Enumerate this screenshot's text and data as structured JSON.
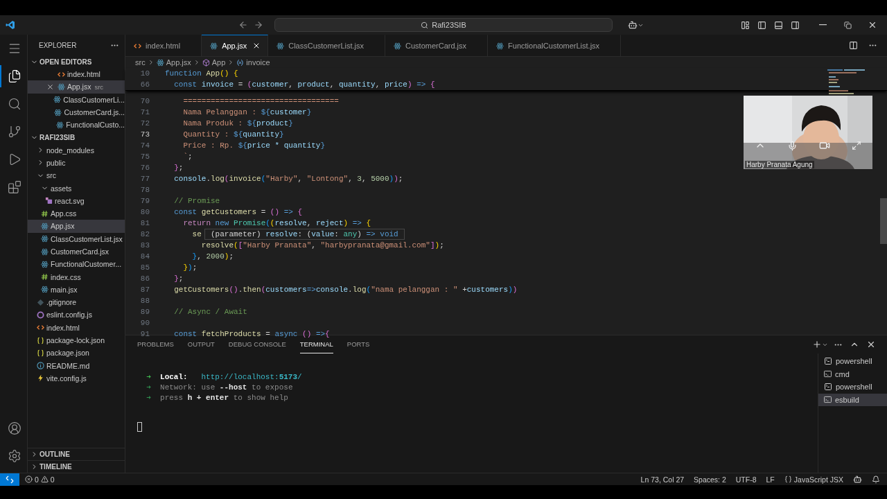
{
  "title_bar": {
    "command_center": "Rafi23SIB"
  },
  "activity_bar": {
    "items": [
      {
        "kind": "menu",
        "selected": false
      },
      {
        "kind": "explorer",
        "selected": true
      },
      {
        "kind": "search",
        "selected": false
      },
      {
        "kind": "source_control",
        "selected": false
      },
      {
        "kind": "run",
        "selected": false
      },
      {
        "kind": "extensions",
        "selected": false
      }
    ],
    "bottom_items": [
      {
        "kind": "account",
        "selected": false
      },
      {
        "kind": "settings",
        "selected": false
      }
    ]
  },
  "sidebar": {
    "title": "EXPLORER",
    "sections": [
      {
        "kind": "open_editors",
        "title": "OPEN EDITORS",
        "expanded": true,
        "items": [
          {
            "label": "index.html",
            "kind": "html",
            "selected": false
          },
          {
            "label": "App.jsx",
            "description": "src",
            "kind": "react",
            "selected": true
          },
          {
            "label": "ClassCustomerLi...",
            "kind": "react",
            "selected": false
          },
          {
            "label": "CustomerCard.js...",
            "kind": "react",
            "selected": false
          },
          {
            "label": "FunctionalCusto...",
            "kind": "react",
            "selected": false
          }
        ]
      },
      {
        "kind": "tree",
        "title": "RAFI23SIB",
        "expanded": true,
        "items": [
          {
            "label": "node_modules",
            "kind": "folder",
            "expanded": false,
            "selected": false
          },
          {
            "label": "public",
            "kind": "folder",
            "expanded": false,
            "selected": false
          },
          {
            "label": "src",
            "kind": "folder",
            "expanded": true,
            "selected": false,
            "children": [
              {
                "label": "assets",
                "kind": "folder",
                "expanded": true,
                "selected": false,
                "children": [
                  {
                    "label": "react.svg",
                    "kind": "svg",
                    "selected": false
                  }
                ]
              },
              {
                "label": "App.css",
                "kind": "css",
                "selected": false
              },
              {
                "label": "App.jsx",
                "kind": "react",
                "selected": true
              },
              {
                "label": "ClassCustomerList.jsx",
                "kind": "react",
                "selected": false
              },
              {
                "label": "CustomerCard.jsx",
                "kind": "react",
                "selected": false
              },
              {
                "label": "FunctionalCustomer...",
                "kind": "react",
                "selected": false
              },
              {
                "label": "index.css",
                "kind": "css",
                "selected": false
              },
              {
                "label": "main.jsx",
                "kind": "react",
                "selected": false
              }
            ]
          },
          {
            "label": ".gitignore",
            "kind": "git",
            "selected": false
          },
          {
            "label": "eslint.config.js",
            "kind": "eslint",
            "selected": false
          },
          {
            "label": "index.html",
            "kind": "html",
            "selected": false
          },
          {
            "label": "package-lock.json",
            "kind": "json",
            "selected": false
          },
          {
            "label": "package.json",
            "kind": "json",
            "selected": false
          },
          {
            "label": "README.md",
            "kind": "info",
            "selected": false
          },
          {
            "label": "vite.config.js",
            "kind": "vite",
            "selected": false
          }
        ]
      },
      {
        "kind": "collapsed",
        "title": "OUTLINE",
        "expanded": false
      },
      {
        "kind": "collapsed",
        "title": "TIMELINE",
        "expanded": false
      }
    ]
  },
  "tabs": [
    {
      "label": "index.html",
      "kind": "html",
      "selected": false
    },
    {
      "label": "App.jsx",
      "kind": "react",
      "selected": true
    },
    {
      "label": "ClassCustomerList.jsx",
      "kind": "react",
      "selected": false
    },
    {
      "label": "CustomerCard.jsx",
      "kind": "react",
      "selected": false
    },
    {
      "label": "FunctionalCustomerList.jsx",
      "kind": "react",
      "selected": false
    }
  ],
  "breadcrumb": [
    {
      "label": "src",
      "kind": "folder"
    },
    {
      "label": "App.jsx",
      "kind": "react"
    },
    {
      "label": "App",
      "kind": "component"
    },
    {
      "label": "invoice",
      "kind": "variable"
    }
  ],
  "editor": {
    "sticky_lines": [
      {
        "number": "10",
        "current": false,
        "tokens": [
          {
            "text": "function ",
            "kind": "kw"
          },
          {
            "text": "App",
            "kind": "fn"
          },
          {
            "text": "() {",
            "kind": "b1"
          }
        ]
      },
      {
        "number": "66",
        "current": false,
        "tokens": [
          {
            "text": "  const ",
            "kind": "kw"
          },
          {
            "text": "invoice",
            "kind": "var"
          },
          {
            "text": " = ",
            "kind": "op"
          },
          {
            "text": "(",
            "kind": "b2"
          },
          {
            "text": "customer",
            "kind": "var"
          },
          {
            "text": ", ",
            "kind": "op"
          },
          {
            "text": "product",
            "kind": "var"
          },
          {
            "text": ", ",
            "kind": "op"
          },
          {
            "text": "quantity",
            "kind": "var"
          },
          {
            "text": ", ",
            "kind": "op"
          },
          {
            "text": "price",
            "kind": "var"
          },
          {
            "text": ")",
            "kind": "b2"
          },
          {
            "text": " => ",
            "kind": "kw"
          },
          {
            "text": "{",
            "kind": "b2"
          }
        ]
      }
    ],
    "lines": [
      {
        "number": "70",
        "current": false,
        "tokens": [
          {
            "text": "    ==================================",
            "kind": "str"
          }
        ]
      },
      {
        "number": "71",
        "current": false,
        "tokens": [
          {
            "text": "    Nama Pelanggan : ",
            "kind": "str"
          },
          {
            "text": "${",
            "kind": "kw"
          },
          {
            "text": "customer",
            "kind": "var"
          },
          {
            "text": "}",
            "kind": "kw"
          }
        ]
      },
      {
        "number": "72",
        "current": false,
        "tokens": [
          {
            "text": "    Nama Produk : ",
            "kind": "str"
          },
          {
            "text": "${",
            "kind": "kw"
          },
          {
            "text": "product",
            "kind": "var"
          },
          {
            "text": "}",
            "kind": "kw"
          }
        ]
      },
      {
        "number": "73",
        "current": true,
        "tokens": [
          {
            "text": "    Quantity : ",
            "kind": "str"
          },
          {
            "text": "${",
            "kind": "kw"
          },
          {
            "text": "quantity",
            "kind": "var"
          },
          {
            "text": "}",
            "kind": "kw"
          }
        ]
      },
      {
        "number": "74",
        "current": false,
        "tokens": [
          {
            "text": "    Price : Rp. ",
            "kind": "str"
          },
          {
            "text": "${",
            "kind": "kw"
          },
          {
            "text": "price * quantity",
            "kind": "var"
          },
          {
            "text": "}",
            "kind": "kw"
          }
        ]
      },
      {
        "number": "75",
        "current": false,
        "tokens": [
          {
            "text": "    `",
            "kind": "str"
          },
          {
            "text": ";",
            "kind": "op"
          }
        ]
      },
      {
        "number": "76",
        "current": false,
        "tokens": [
          {
            "text": "  }",
            "kind": "b2"
          },
          {
            "text": ";",
            "kind": "op"
          }
        ]
      },
      {
        "number": "77",
        "current": false,
        "tokens": [
          {
            "text": "  console",
            "kind": "var"
          },
          {
            "text": ".",
            "kind": "op"
          },
          {
            "text": "log",
            "kind": "fn"
          },
          {
            "text": "(",
            "kind": "b2"
          },
          {
            "text": "invoice",
            "kind": "fn"
          },
          {
            "text": "(",
            "kind": "b3"
          },
          {
            "text": "\"Harby\"",
            "kind": "str"
          },
          {
            "text": ", ",
            "kind": "op"
          },
          {
            "text": "\"Lontong\"",
            "kind": "str"
          },
          {
            "text": ", ",
            "kind": "op"
          },
          {
            "text": "3",
            "kind": "num"
          },
          {
            "text": ", ",
            "kind": "op"
          },
          {
            "text": "5000",
            "kind": "num"
          },
          {
            "text": ")",
            "kind": "b3"
          },
          {
            "text": ")",
            "kind": "b2"
          },
          {
            "text": ";",
            "kind": "op"
          }
        ]
      },
      {
        "number": "78",
        "current": false
      },
      {
        "number": "79",
        "current": false,
        "tokens": [
          {
            "text": "  // Promise",
            "kind": "cmt"
          }
        ]
      },
      {
        "number": "80",
        "current": false,
        "tokens": [
          {
            "text": "  const ",
            "kind": "kw"
          },
          {
            "text": "getCustomers",
            "kind": "fn"
          },
          {
            "text": " = ",
            "kind": "op"
          },
          {
            "text": "()",
            "kind": "b2"
          },
          {
            "text": " => ",
            "kind": "kw"
          },
          {
            "text": "{",
            "kind": "b2"
          }
        ]
      },
      {
        "number": "81",
        "current": false,
        "tokens": [
          {
            "text": "    return",
            "kind": "ctl"
          },
          {
            "text": " new ",
            "kind": "kw"
          },
          {
            "text": "Promise",
            "kind": "type"
          },
          {
            "text": "(",
            "kind": "b3"
          },
          {
            "text": "(",
            "kind": "b1"
          },
          {
            "text": "resolve",
            "kind": "var"
          },
          {
            "text": ", ",
            "kind": "op"
          },
          {
            "text": "reject",
            "kind": "var"
          },
          {
            "text": ")",
            "kind": "b1"
          },
          {
            "text": " => ",
            "kind": "kw"
          },
          {
            "text": "{",
            "kind": "b1"
          }
        ]
      },
      {
        "number": "82",
        "current": false,
        "tokens": [
          {
            "text": "      se",
            "kind": "fn"
          }
        ],
        "hover": [
          {
            "text": "(parameter) ",
            "kind": "op"
          },
          {
            "text": "resolve",
            "kind": "var"
          },
          {
            "text": ": (",
            "kind": "op"
          },
          {
            "text": "value",
            "kind": "var"
          },
          {
            "text": ": ",
            "kind": "op"
          },
          {
            "text": "any",
            "kind": "type"
          },
          {
            "text": ") ",
            "kind": "op"
          },
          {
            "text": "=> void",
            "kind": "kw"
          }
        ]
      },
      {
        "number": "83",
        "current": false,
        "tokens": [
          {
            "text": "        resolve",
            "kind": "fn"
          },
          {
            "text": "(",
            "kind": "b1"
          },
          {
            "text": "[",
            "kind": "b2"
          },
          {
            "text": "\"Harby Pranata\"",
            "kind": "str"
          },
          {
            "text": ", ",
            "kind": "op"
          },
          {
            "text": "\"harbypranata@gmail.com\"",
            "kind": "str"
          },
          {
            "text": "]",
            "kind": "b2"
          },
          {
            "text": ")",
            "kind": "b1"
          },
          {
            "text": ";",
            "kind": "op"
          }
        ]
      },
      {
        "number": "84",
        "current": false,
        "tokens": [
          {
            "text": "      }",
            "kind": "b3"
          },
          {
            "text": ", ",
            "kind": "op"
          },
          {
            "text": "2000",
            "kind": "num"
          },
          {
            "text": ")",
            "kind": "b1"
          },
          {
            "text": ";",
            "kind": "op"
          }
        ]
      },
      {
        "number": "85",
        "current": false,
        "tokens": [
          {
            "text": "    }",
            "kind": "b1"
          },
          {
            "text": ")",
            "kind": "b3"
          },
          {
            "text": ";",
            "kind": "op"
          }
        ]
      },
      {
        "number": "86",
        "current": false,
        "tokens": [
          {
            "text": "  }",
            "kind": "b2"
          },
          {
            "text": ";",
            "kind": "op"
          }
        ]
      },
      {
        "number": "87",
        "current": false,
        "tokens": [
          {
            "text": "  getCustomers",
            "kind": "fn"
          },
          {
            "text": "()",
            "kind": "b2"
          },
          {
            "text": ".",
            "kind": "op"
          },
          {
            "text": "then",
            "kind": "fn"
          },
          {
            "text": "(",
            "kind": "b2"
          },
          {
            "text": "customers",
            "kind": "var"
          },
          {
            "text": "=>",
            "kind": "kw"
          },
          {
            "text": "console",
            "kind": "var"
          },
          {
            "text": ".",
            "kind": "op"
          },
          {
            "text": "log",
            "kind": "fn"
          },
          {
            "text": "(",
            "kind": "b3"
          },
          {
            "text": "\"nama pelanggan : \"",
            "kind": "str"
          },
          {
            "text": " +",
            "kind": "op"
          },
          {
            "text": "customers",
            "kind": "var"
          },
          {
            "text": ")",
            "kind": "b3"
          },
          {
            "text": ")",
            "kind": "b2"
          }
        ]
      },
      {
        "number": "88",
        "current": false
      },
      {
        "number": "89",
        "current": false,
        "tokens": [
          {
            "text": "  // Async / Await",
            "kind": "cmt"
          }
        ]
      },
      {
        "number": "90",
        "current": false
      },
      {
        "number": "91",
        "current": false,
        "tokens": [
          {
            "text": "  const ",
            "kind": "kw"
          },
          {
            "text": "fetchProducts",
            "kind": "fn"
          },
          {
            "text": " = ",
            "kind": "op"
          },
          {
            "text": "async",
            "kind": "kw"
          },
          {
            "text": " () ",
            "kind": "b2"
          },
          {
            "text": "=>",
            "kind": "kw"
          },
          {
            "text": "{",
            "kind": "b2"
          }
        ]
      }
    ]
  },
  "video_call": {
    "kind": "picture",
    "name": "Harby Pranata Agung"
  },
  "panel": {
    "tabs": [
      {
        "label": "PROBLEMS",
        "selected": false
      },
      {
        "label": "OUTPUT",
        "selected": false
      },
      {
        "label": "DEBUG CONSOLE",
        "selected": false
      },
      {
        "label": "TERMINAL",
        "selected": true
      },
      {
        "label": "PORTS",
        "selected": false
      }
    ],
    "terminal_lines": [
      {
        "tokens": [
          {
            "text": "  ➜  ",
            "kind": "arrow"
          },
          {
            "text": "Local",
            "kind": "label"
          },
          {
            "text": ":   ",
            "kind": "label"
          },
          {
            "text": "http://localhost:",
            "kind": "url"
          },
          {
            "text": "5173",
            "kind": "url_bold"
          },
          {
            "text": "/",
            "kind": "url"
          }
        ]
      },
      {
        "tokens": [
          {
            "text": "  ➜  ",
            "kind": "arrow_dim"
          },
          {
            "text": "Network",
            "kind": "dim"
          },
          {
            "text": ": use ",
            "kind": "dim"
          },
          {
            "text": "--host",
            "kind": "bold"
          },
          {
            "text": " to expose",
            "kind": "dim"
          }
        ]
      },
      {
        "tokens": [
          {
            "text": "  ➜  ",
            "kind": "arrow_dim"
          },
          {
            "text": "press ",
            "kind": "dim"
          },
          {
            "text": "h + enter",
            "kind": "bold"
          },
          {
            "text": " to show help",
            "kind": "dim"
          }
        ]
      }
    ],
    "terminals": [
      {
        "label": "powershell",
        "kind": "powershell",
        "selected": false
      },
      {
        "label": "cmd",
        "kind": "cmd",
        "selected": false
      },
      {
        "label": "powershell",
        "kind": "powershell",
        "selected": false
      },
      {
        "label": "esbuild",
        "kind": "cmd",
        "selected": true
      }
    ]
  },
  "status_bar": {
    "errors": "0",
    "warnings": "0",
    "position": "Ln 73, Col 27",
    "indentation": "Spaces: 2",
    "encoding": "UTF-8",
    "eol": "LF",
    "language": "JavaScript JSX"
  }
}
